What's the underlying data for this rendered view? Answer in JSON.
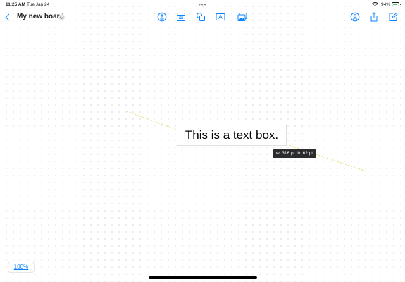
{
  "status_bar": {
    "time": "11:25 AM",
    "date": "Tue Jan 24",
    "battery_percent": "94%",
    "battery_level": 0.94,
    "multitask_dots": "•••"
  },
  "toolbar": {
    "title": "My new board",
    "icons": [
      "back-chevron-icon",
      "chevron-down-icon",
      "pen-tip-icon",
      "sticky-note-icon",
      "shapes-icon",
      "text-box-icon",
      "media-icon",
      "collaboration-icon",
      "share-icon",
      "compose-icon"
    ]
  },
  "canvas": {
    "text_box": {
      "text": "This is a text box."
    },
    "size_tooltip": {
      "width": "w: 316 pt",
      "height": "h: 62 pt"
    },
    "accent": "#0a84ff",
    "guide_color": "#e6e08a"
  },
  "zoom": {
    "label": "100%"
  }
}
